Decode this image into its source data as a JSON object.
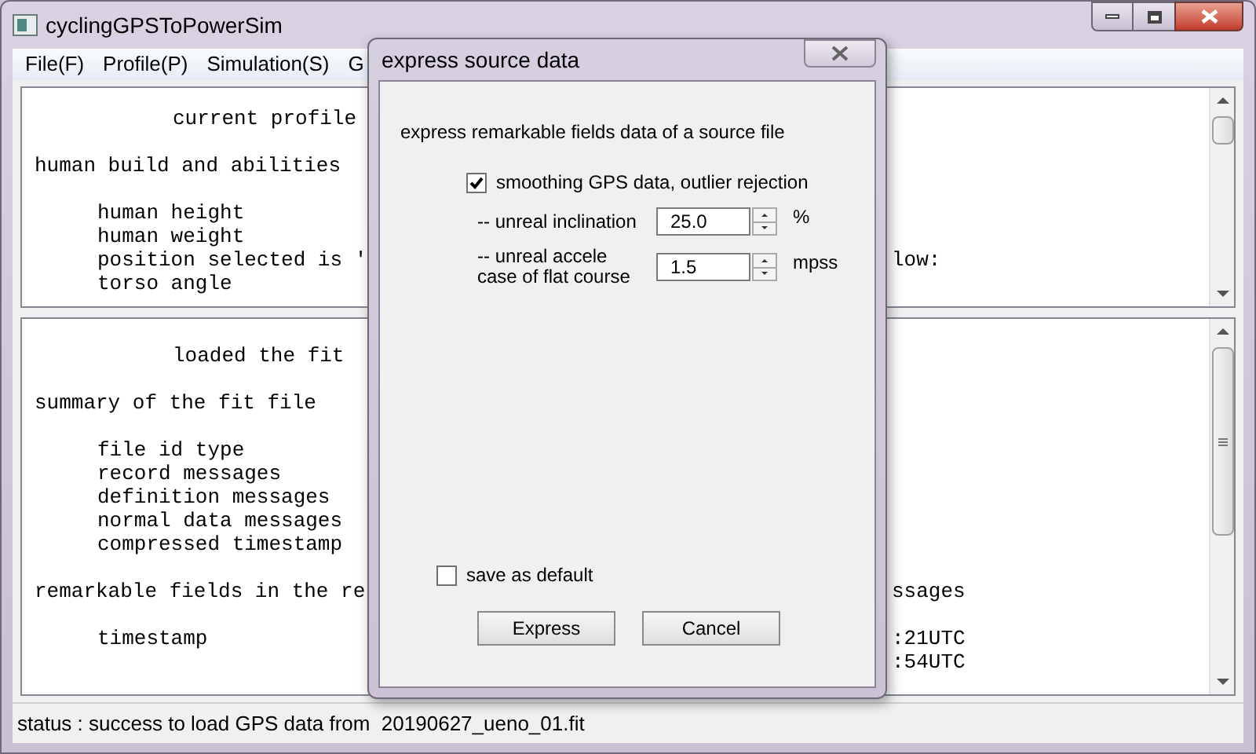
{
  "window": {
    "title": "cyclingGPSToPowerSim"
  },
  "menu": [
    {
      "label": "File(F)"
    },
    {
      "label": "Profile(P)"
    },
    {
      "label": "Simulation(S)"
    },
    {
      "label": "G"
    }
  ],
  "profile_pane": {
    "lines": [
      {
        "kind": "heading",
        "text": "current profile"
      },
      {
        "kind": "blank"
      },
      {
        "kind": "section",
        "text": "human build and abilities"
      },
      {
        "kind": "blank"
      },
      {
        "kind": "item",
        "text": "human height"
      },
      {
        "kind": "item",
        "text": "human weight"
      },
      {
        "kind": "item",
        "text": "position selected is '",
        "right": "low:"
      },
      {
        "kind": "item",
        "text": "torso angle"
      }
    ]
  },
  "fit_pane": {
    "lines": [
      {
        "kind": "heading",
        "text": "loaded the fit"
      },
      {
        "kind": "blank"
      },
      {
        "kind": "section",
        "text": "summary of the fit file"
      },
      {
        "kind": "blank"
      },
      {
        "kind": "item",
        "text": "file id type"
      },
      {
        "kind": "item",
        "text": "record messages"
      },
      {
        "kind": "item",
        "text": "definition messages"
      },
      {
        "kind": "item",
        "text": "normal data messages"
      },
      {
        "kind": "item",
        "text": "compressed timestamp"
      },
      {
        "kind": "blank"
      },
      {
        "kind": "section",
        "text": "remarkable fields in the re",
        "right": "ssages"
      },
      {
        "kind": "blank"
      },
      {
        "kind": "item",
        "text": "timestamp",
        "right": ":21UTC"
      },
      {
        "kind": "item",
        "right": ":54UTC"
      }
    ]
  },
  "status_bar": {
    "text": "status : success to load GPS data from  20190627_ueno_01.fit"
  },
  "dialog": {
    "title": "express source data",
    "heading": "express remarkable fields data of a source file",
    "smoothing": {
      "label": "smoothing GPS data, outlier rejection",
      "checked": true
    },
    "fields": [
      {
        "label": "-- unreal inclination",
        "value": "25.0",
        "unit": "%"
      },
      {
        "label": "-- unreal accele",
        "label_2": "case of flat course",
        "value": "1.5",
        "unit": "mpss"
      }
    ],
    "save_default": {
      "label": "save as default",
      "checked": false
    },
    "buttons": [
      {
        "label": "Express"
      },
      {
        "label": "Cancel"
      }
    ]
  }
}
